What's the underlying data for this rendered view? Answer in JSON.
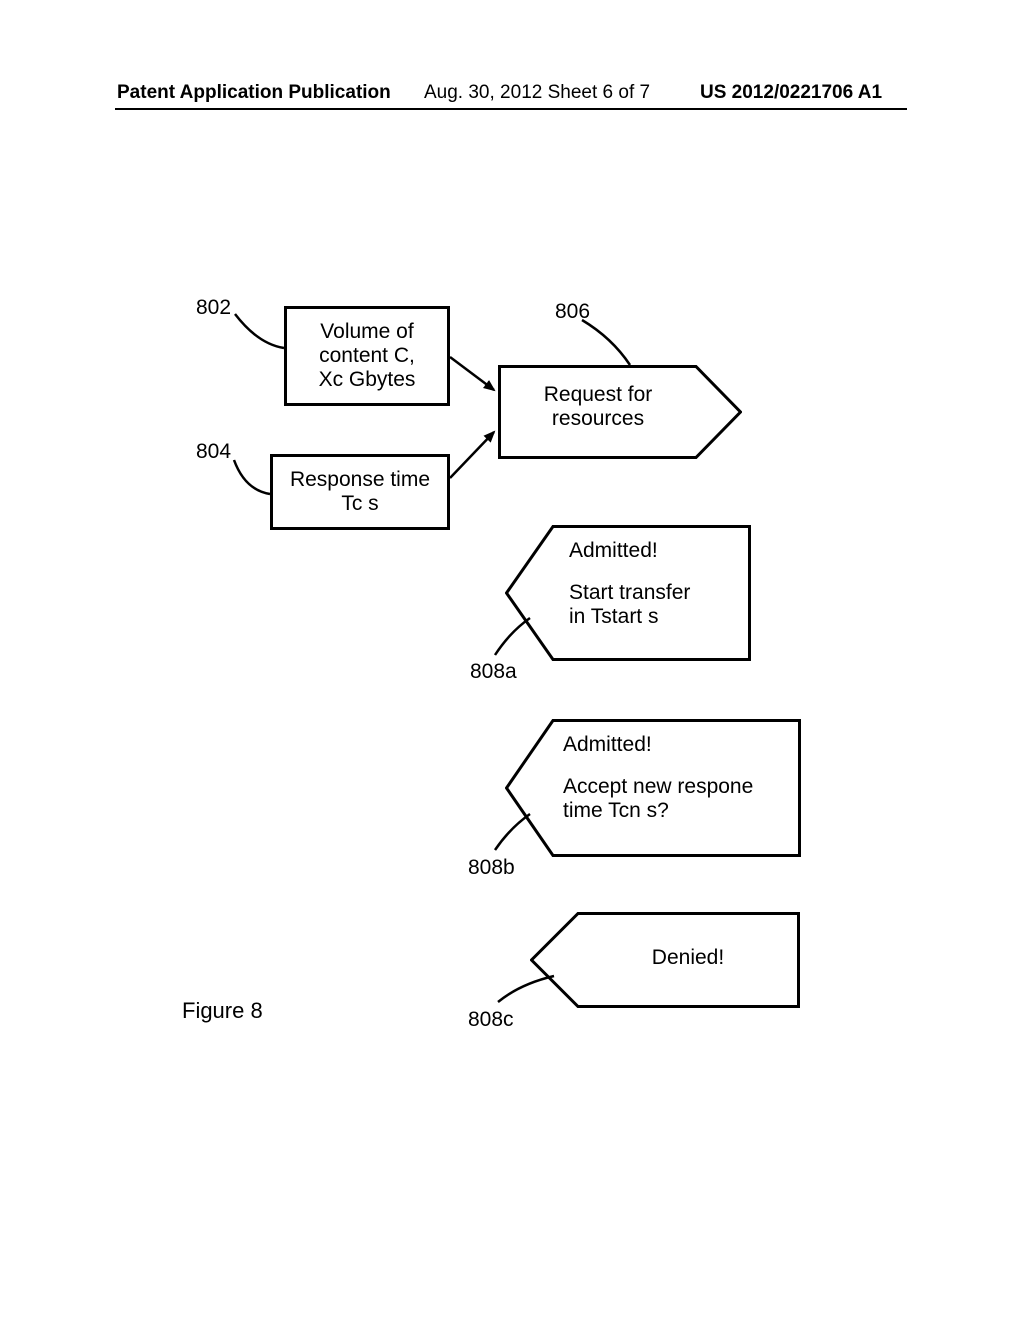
{
  "header": {
    "left": "Patent Application Publication",
    "mid": "Aug. 30, 2012  Sheet 6 of 7",
    "right": "US 2012/0221706 A1"
  },
  "refs": {
    "r802": "802",
    "r804": "804",
    "r806": "806",
    "r808a": "808a",
    "r808b": "808b",
    "r808c": "808c"
  },
  "boxes": {
    "b802_line1": "Volume of",
    "b802_line2": "content C,",
    "b802_line3": "Xc Gbytes",
    "b804_line1": "Response time",
    "b804_line2": "Tc s"
  },
  "shapes": {
    "request_line1": "Request for",
    "request_line2": "resources",
    "resp_a_line1": "Admitted!",
    "resp_a_line2": "Start transfer",
    "resp_a_line3": "in Tstart s",
    "resp_b_line1": "Admitted!",
    "resp_b_line2": "Accept new respone",
    "resp_b_line3": "time Tcn s?",
    "resp_c_line1": "Denied!"
  },
  "figure_caption": "Figure 8"
}
